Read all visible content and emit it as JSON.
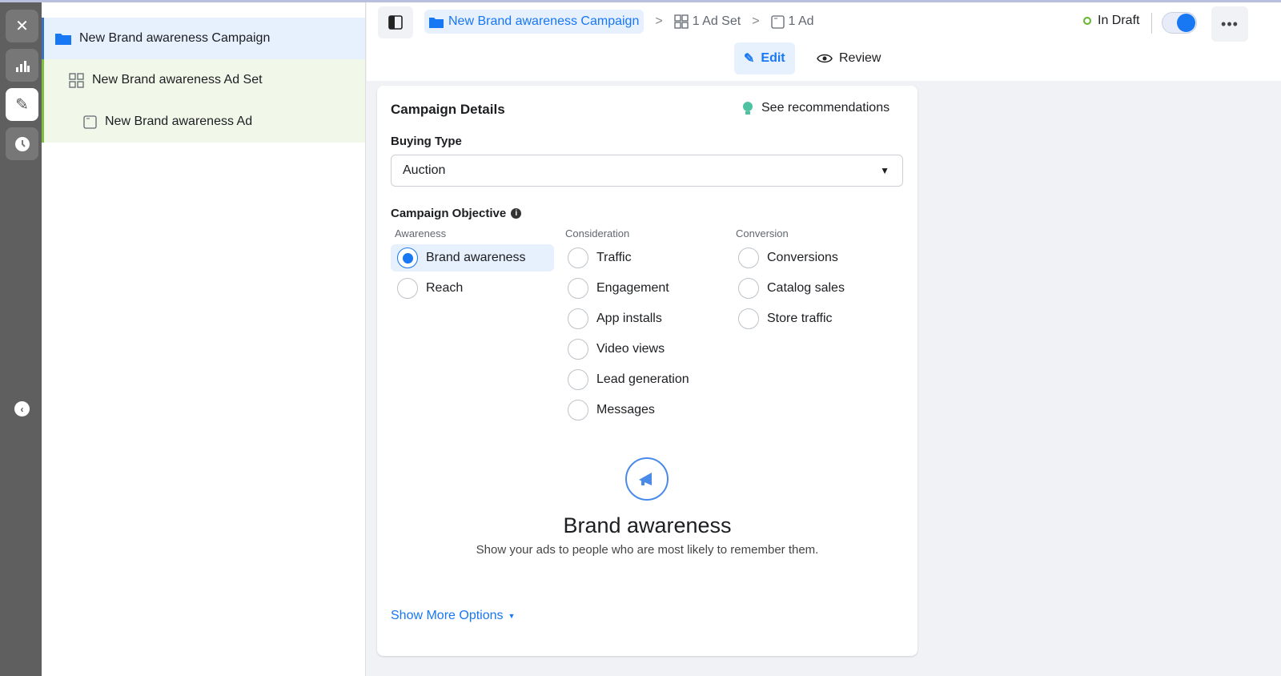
{
  "tree": {
    "campaign": "New Brand awareness Campaign",
    "adset": "New Brand awareness Ad Set",
    "ad": "New Brand awareness Ad"
  },
  "breadcrumb": {
    "campaign": "New Brand awareness Campaign",
    "adset": "1 Ad Set",
    "ad": "1 Ad"
  },
  "status": "In Draft",
  "modes": {
    "edit": "Edit",
    "review": "Review"
  },
  "card": {
    "title": "Campaign Details",
    "recommendations": "See recommendations",
    "buying_type_label": "Buying Type",
    "buying_type_value": "Auction",
    "objective_label": "Campaign Objective",
    "columns": [
      {
        "heading": "Awareness",
        "options": [
          "Brand awareness",
          "Reach"
        ]
      },
      {
        "heading": "Consideration",
        "options": [
          "Traffic",
          "Engagement",
          "App installs",
          "Video views",
          "Lead generation",
          "Messages"
        ]
      },
      {
        "heading": "Conversion",
        "options": [
          "Conversions",
          "Catalog sales",
          "Store traffic"
        ]
      }
    ],
    "selected": "Brand awareness",
    "hero_title": "Brand awareness",
    "hero_desc": "Show your ads to people who are most likely to remember them.",
    "show_more": "Show More Options"
  },
  "colors": {
    "accent": "#1877f2",
    "draft": "#63b52a"
  }
}
